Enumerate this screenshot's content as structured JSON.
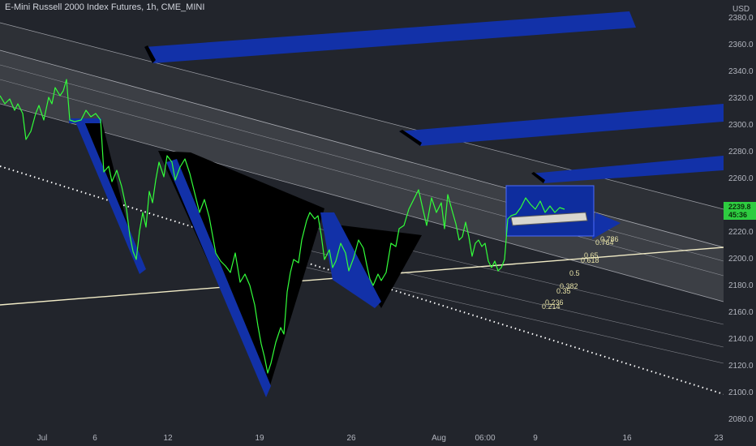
{
  "header": {
    "title": "E-Mini Russell 2000 Index Futures, 1h, CME_MINI"
  },
  "price_axis": {
    "currency": "USD",
    "current_price": "2239.8",
    "countdown": "45:36"
  },
  "fib_labels": [
    "0.786",
    "0.764",
    "0.65",
    "0.618",
    "0.5",
    "0.382",
    "0.35",
    "0.236",
    "0.214"
  ],
  "colors": {
    "background": "#22252c",
    "price_line": "#32ff3a",
    "pattern_fill": "#000000",
    "shadow_blue": "#1231a8",
    "channel_band": "rgba(255,255,255,0.13)",
    "trendline": "#f2ecc7",
    "dotted_line": "#ffffff",
    "current_price_tag": "#2ecc40"
  },
  "chart_data": {
    "type": "line",
    "title": "E-Mini Russell 2000 Index Futures, 1h, CME_MINI",
    "ylabel": "USD",
    "ylim": [
      2076,
      2392
    ],
    "grid": false,
    "x_tick_labels": [
      "Jul",
      "6",
      "12",
      "19",
      "26",
      "Aug",
      "06:00",
      "9",
      "16",
      "23"
    ],
    "y_tick_labels": [
      "2080.0",
      "2100.0",
      "2120.0",
      "2140.0",
      "2160.0",
      "2180.0",
      "2200.0",
      "2220.0",
      "2240.0",
      "2260.0",
      "2280.0",
      "2300.0",
      "2320.0",
      "2340.0",
      "2360.0",
      "2380.0"
    ],
    "series": [
      {
        "x": [
          "Jun 30",
          "Jul 1",
          "Jul 2",
          "Jul 3",
          "Jul 5",
          "Jul 6",
          "Jul 7",
          "Jul 8",
          "Jul 9",
          "Jul 10",
          "Jul 12",
          "Jul 13",
          "Jul 14",
          "Jul 15",
          "Jul 16",
          "Jul 19",
          "Jul 20",
          "Jul 21",
          "Jul 22",
          "Jul 23",
          "Jul 26",
          "Jul 27",
          "Jul 28",
          "Jul 29",
          "Jul 30",
          "Aug 2",
          "Aug 3",
          "Aug 4",
          "Aug 5",
          "Aug 6"
        ],
        "values": [
          2320,
          2305,
          2322,
          2335,
          2300,
          2298,
          2250,
          2195,
          2240,
          2215,
          2270,
          2235,
          2200,
          2172,
          2150,
          2110,
          2175,
          2195,
          2235,
          2193,
          2208,
          2175,
          2222,
          2240,
          2225,
          2195,
          2198,
          2240,
          2238,
          2240
        ]
      }
    ]
  }
}
